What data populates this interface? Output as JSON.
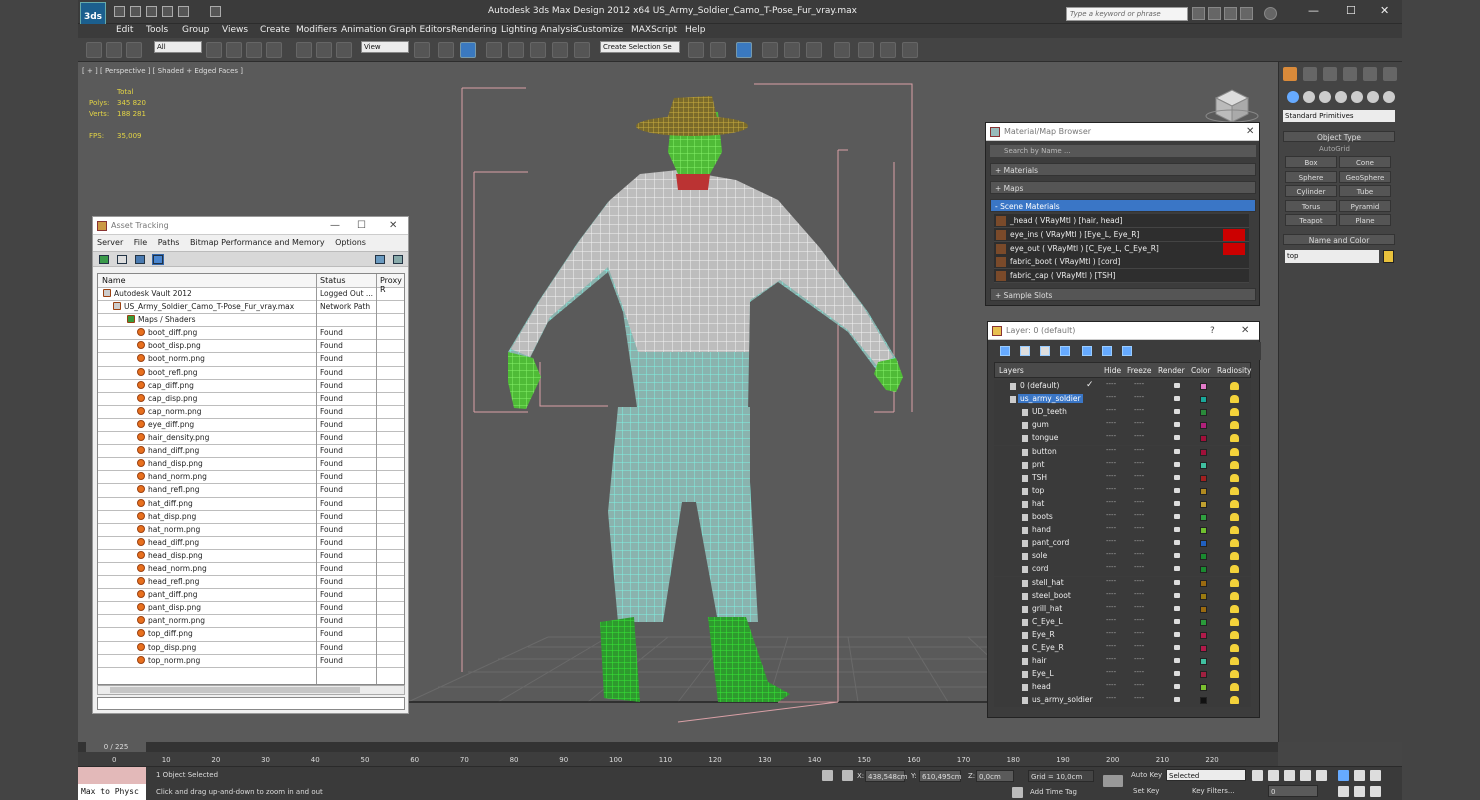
{
  "app": {
    "title": "Autodesk 3ds Max Design 2012 x64      US_Army_Soldier_Camo_T-Pose_Fur_vray.max",
    "logo_text": "3ds",
    "search_placeholder": "Type a keyword or phrase",
    "window_controls": {
      "minimize": "—",
      "maximize": "☐",
      "close": "✕"
    }
  },
  "menu": [
    "Edit",
    "Tools",
    "Group",
    "Views",
    "Create",
    "Modifiers",
    "Animation",
    "Graph Editors",
    "Rendering",
    "Lighting Analysis",
    "Customize",
    "MAXScript",
    "Help"
  ],
  "toolbar": {
    "selection_filter": "All",
    "ref_coord": "View",
    "named_selection": "Create Selection Se"
  },
  "viewport": {
    "label": "[ + ] [ Perspective ] [ Shaded + Edged Faces ]",
    "stats": {
      "total_label": "Total",
      "polys_label": "Polys:",
      "polys": "345 820",
      "verts_label": "Verts:",
      "verts": "188 281",
      "fps_label": "FPS:",
      "fps": "35,009"
    }
  },
  "asset_tracking": {
    "title": "Asset Tracking",
    "menu": [
      "Server",
      "File",
      "Paths",
      "Bitmap Performance and Memory",
      "Options"
    ],
    "columns": {
      "name": "Name",
      "status": "Status",
      "proxy": "Proxy R"
    },
    "rows": [
      {
        "name": "Autodesk Vault 2012",
        "status": "Logged Out ..."
      },
      {
        "name": "US_Army_Soldier_Camo_T-Pose_Fur_vray.max",
        "status": "Network Path"
      },
      {
        "name": "Maps / Shaders",
        "status": ""
      },
      {
        "name": "boot_diff.png",
        "status": "Found"
      },
      {
        "name": "boot_disp.png",
        "status": "Found"
      },
      {
        "name": "boot_norm.png",
        "status": "Found"
      },
      {
        "name": "boot_refl.png",
        "status": "Found"
      },
      {
        "name": "cap_diff.png",
        "status": "Found"
      },
      {
        "name": "cap_disp.png",
        "status": "Found"
      },
      {
        "name": "cap_norm.png",
        "status": "Found"
      },
      {
        "name": "eye_diff.png",
        "status": "Found"
      },
      {
        "name": "hair_density.png",
        "status": "Found"
      },
      {
        "name": "hand_diff.png",
        "status": "Found"
      },
      {
        "name": "hand_disp.png",
        "status": "Found"
      },
      {
        "name": "hand_norm.png",
        "status": "Found"
      },
      {
        "name": "hand_refl.png",
        "status": "Found"
      },
      {
        "name": "hat_diff.png",
        "status": "Found"
      },
      {
        "name": "hat_disp.png",
        "status": "Found"
      },
      {
        "name": "hat_norm.png",
        "status": "Found"
      },
      {
        "name": "head_diff.png",
        "status": "Found"
      },
      {
        "name": "head_disp.png",
        "status": "Found"
      },
      {
        "name": "head_norm.png",
        "status": "Found"
      },
      {
        "name": "head_refl.png",
        "status": "Found"
      },
      {
        "name": "pant_diff.png",
        "status": "Found"
      },
      {
        "name": "pant_disp.png",
        "status": "Found"
      },
      {
        "name": "pant_norm.png",
        "status": "Found"
      },
      {
        "name": "top_diff.png",
        "status": "Found"
      },
      {
        "name": "top_disp.png",
        "status": "Found"
      },
      {
        "name": "top_norm.png",
        "status": "Found"
      }
    ]
  },
  "material_browser": {
    "title": "Material/Map Browser",
    "search_placeholder": "Search by Name ...",
    "groups": {
      "materials": "+ Materials",
      "maps": "+ Maps",
      "scene": "- Scene Materials",
      "sample": "+ Sample Slots"
    },
    "scene_materials": [
      {
        "name": "_head  ( VRayMtl ) [hair, head]",
        "flag": false
      },
      {
        "name": "eye_ins  ( VRayMtl ) [Eye_L, Eye_R]",
        "flag": true
      },
      {
        "name": "eye_out  ( VRayMtl ) [C_Eye_L, C_Eye_R]",
        "flag": true
      },
      {
        "name": "fabric_boot  ( VRayMtl ) [cord]",
        "flag": false
      },
      {
        "name": "fabric_cap  ( VRayMtl ) [TSH]",
        "flag": false
      }
    ]
  },
  "layer_window": {
    "title": "Layer: 0 (default)",
    "help": "?",
    "columns": {
      "layers": "Layers",
      "hide": "Hide",
      "freeze": "Freeze",
      "render": "Render",
      "color": "Color",
      "radiosity": "Radiosity"
    },
    "rows": [
      {
        "name": "0 (default)",
        "color": "#e27ac8",
        "level": 0,
        "check": "✓"
      },
      {
        "name": "us_army_soldier",
        "color": "#1aa89a",
        "level": 0,
        "selected": true
      },
      {
        "name": "UD_teeth",
        "color": "#2a8a3a",
        "level": 1
      },
      {
        "name": "gum",
        "color": "#b0207a",
        "level": 1
      },
      {
        "name": "tongue",
        "color": "#a0103a",
        "level": 1
      },
      {
        "name": "button",
        "color": "#a0103a",
        "level": 1
      },
      {
        "name": "pnt",
        "color": "#40c0a0",
        "level": 1
      },
      {
        "name": "TSH",
        "color": "#a02020",
        "level": 1
      },
      {
        "name": "top",
        "color": "#b08a20",
        "level": 1
      },
      {
        "name": "hat",
        "color": "#c0a030",
        "level": 1
      },
      {
        "name": "boots",
        "color": "#30a040",
        "level": 1
      },
      {
        "name": "hand",
        "color": "#70c030",
        "level": 1
      },
      {
        "name": "pant_cord",
        "color": "#2060c0",
        "level": 1
      },
      {
        "name": "sole",
        "color": "#1a8a30",
        "level": 1
      },
      {
        "name": "cord",
        "color": "#1a8a30",
        "level": 1
      },
      {
        "name": "stell_hat",
        "color": "#9a6a10",
        "level": 1
      },
      {
        "name": "steel_boot",
        "color": "#9a7a10",
        "level": 1
      },
      {
        "name": "grill_hat",
        "color": "#9a6a10",
        "level": 1
      },
      {
        "name": "C_Eye_L",
        "color": "#2a9a3a",
        "level": 1
      },
      {
        "name": "Eye_R",
        "color": "#b01a4a",
        "level": 1
      },
      {
        "name": "C_Eye_R",
        "color": "#b01a4a",
        "level": 1
      },
      {
        "name": "hair",
        "color": "#40c0a0",
        "level": 1
      },
      {
        "name": "Eye_L",
        "color": "#a02040",
        "level": 1
      },
      {
        "name": "head",
        "color": "#7ac030",
        "level": 1
      },
      {
        "name": "us_army_soldier",
        "color": "#111111",
        "level": 1
      }
    ]
  },
  "command_panel": {
    "dropdown": "Standard Primitives",
    "object_type_label": "Object Type",
    "autogrid": "AutoGrid",
    "buttons": [
      "Box",
      "Cone",
      "Sphere",
      "GeoSphere",
      "Cylinder",
      "Tube",
      "Torus",
      "Pyramid",
      "Teapot",
      "Plane"
    ],
    "name_color_label": "Name and Color",
    "object_name": "top"
  },
  "timeline": {
    "slider": "0 / 225",
    "ticks": [
      "0",
      "10",
      "20",
      "30",
      "40",
      "50",
      "60",
      "70",
      "80",
      "90",
      "100",
      "110",
      "120",
      "130",
      "140",
      "150",
      "160",
      "170",
      "180",
      "190",
      "200",
      "210",
      "220"
    ]
  },
  "statusbar": {
    "maxscript": "Max to Physc",
    "selection": "1 Object Selected",
    "prompt": "Click and drag up-and-down to zoom in and out",
    "x_label": "X:",
    "x": "438,548cm",
    "y_label": "Y:",
    "y": "610,495cm",
    "z_label": "Z:",
    "z": "0,0cm",
    "grid": "Grid = 10,0cm",
    "add_time_tag": "Add Time Tag",
    "auto_key": "Auto Key",
    "set_key": "Set Key",
    "key_dropdown": "Selected",
    "key_filters": "Key Filters...",
    "frame": "0"
  }
}
